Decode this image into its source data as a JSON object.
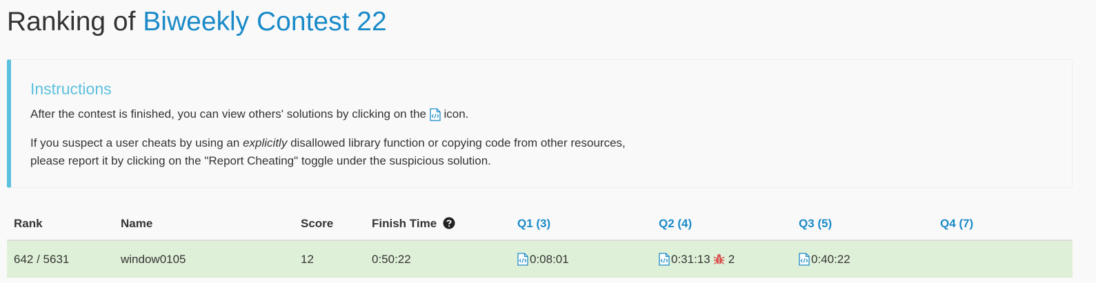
{
  "header": {
    "title_prefix": "Ranking of",
    "contest_name": "Biweekly Contest 22"
  },
  "instructions": {
    "heading": "Instructions",
    "line1_before_icon": "After the contest is finished, you can view others' solutions by clicking on the",
    "line1_after_icon": "icon.",
    "line2_before_emphasis": "If you suspect a user cheats by using an",
    "line2_emphasis": "explicitly",
    "line2_after_emphasis": "disallowed library function or copying code from other resources,",
    "line3": "please report it by clicking on the \"Report Cheating\" toggle under the suspicious solution."
  },
  "table": {
    "columns": [
      "Rank",
      "Name",
      "Score",
      "Finish Time",
      "Q1 (3)",
      "Q2 (4)",
      "Q3 (5)",
      "Q4 (7)"
    ],
    "rows": [
      {
        "rank": "642 / 5631",
        "name": "window0105",
        "score": "12",
        "finish_time": "0:50:22",
        "q1": "0:08:01",
        "q2": "0:31:13",
        "q2_bug_count": "2",
        "q3": "0:40:22",
        "q4": ""
      }
    ]
  },
  "colors": {
    "link": "#1a8ac8",
    "callout_accent": "#5bc0de",
    "row_highlight": "#dff0d8",
    "bug": "#d9534f"
  },
  "icons": {
    "solution": "code-file-icon",
    "help": "question-circle-icon",
    "wrong_answer": "bug-icon"
  }
}
